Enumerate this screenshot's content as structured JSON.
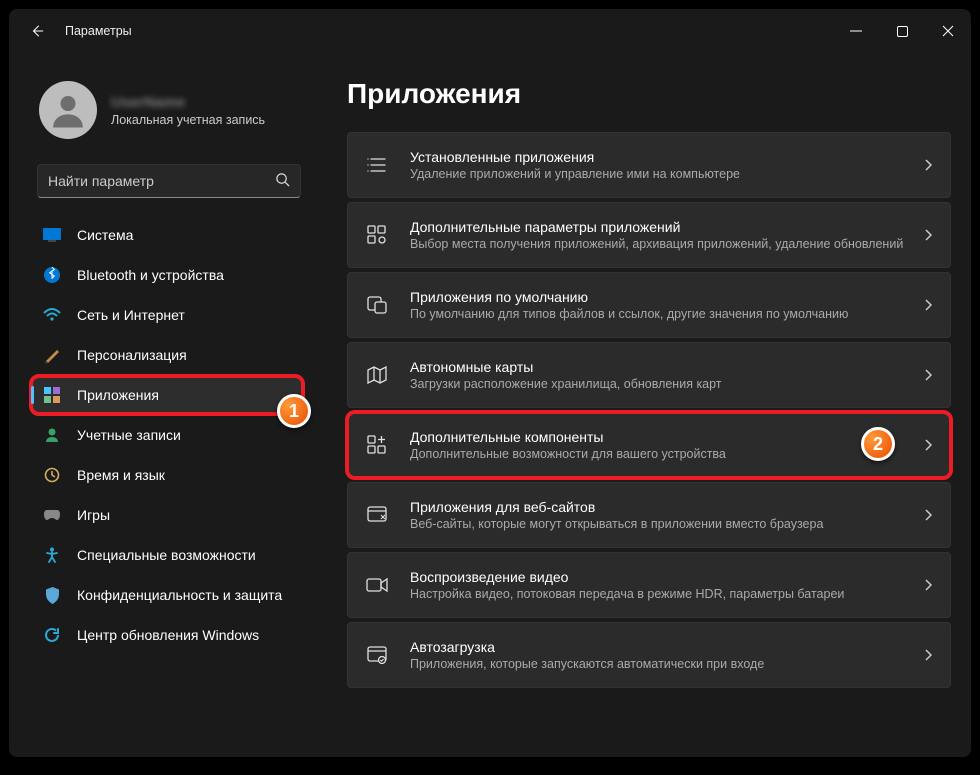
{
  "titlebar": {
    "title": "Параметры"
  },
  "account": {
    "name": "UserName",
    "type": "Локальная учетная запись"
  },
  "search": {
    "placeholder": "Найти параметр"
  },
  "nav": {
    "items": [
      {
        "label": "Система"
      },
      {
        "label": "Bluetooth и устройства"
      },
      {
        "label": "Сеть и Интернет"
      },
      {
        "label": "Персонализация"
      },
      {
        "label": "Приложения"
      },
      {
        "label": "Учетные записи"
      },
      {
        "label": "Время и язык"
      },
      {
        "label": "Игры"
      },
      {
        "label": "Специальные возможности"
      },
      {
        "label": "Конфиденциальность и защита"
      },
      {
        "label": "Центр обновления Windows"
      }
    ]
  },
  "page": {
    "title": "Приложения"
  },
  "cards": [
    {
      "title": "Установленные приложения",
      "sub": "Удаление приложений и управление ими на компьютере"
    },
    {
      "title": "Дополнительные параметры приложений",
      "sub": "Выбор места получения приложений, архивация приложений, удаление обновлений"
    },
    {
      "title": "Приложения по умолчанию",
      "sub": "По умолчанию для типов файлов и ссылок, другие значения по умолчанию"
    },
    {
      "title": "Автономные карты",
      "sub": "Загрузки расположение хранилища, обновления карт"
    },
    {
      "title": "Дополнительные компоненты",
      "sub": "Дополнительные возможности для вашего устройства"
    },
    {
      "title": "Приложения для веб-сайтов",
      "sub": "Веб-сайты, которые могут открываться в приложении вместо браузера"
    },
    {
      "title": "Воспроизведение видео",
      "sub": "Настройка видео, потоковая передача в режиме HDR, параметры батареи"
    },
    {
      "title": "Автозагрузка",
      "sub": "Приложения, которые запускаются автоматически при входе"
    }
  ],
  "steps": {
    "one": "1",
    "two": "2"
  }
}
